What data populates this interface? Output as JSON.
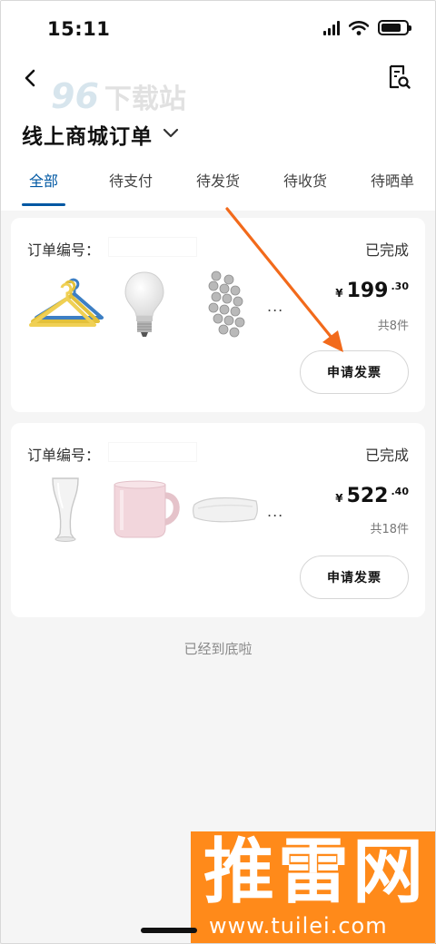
{
  "status_bar": {
    "time": "15:11"
  },
  "header": {
    "title": "线上商城订单"
  },
  "watermark": {
    "logo_num": "96",
    "logo_text": "下载站"
  },
  "tabs": [
    {
      "label": "全部",
      "active": true
    },
    {
      "label": "待支付",
      "active": false
    },
    {
      "label": "待发货",
      "active": false
    },
    {
      "label": "待收货",
      "active": false
    },
    {
      "label": "待晒单",
      "active": false
    }
  ],
  "orders": [
    {
      "order_label": "订单编号：",
      "status": "已完成",
      "price_symbol": "¥",
      "price_int": "199",
      "price_dec": ".30",
      "count": "共8件",
      "button": "申请发票",
      "items": [
        "hangers",
        "light-bulb",
        "hexagon-mirror"
      ],
      "more": "..."
    },
    {
      "order_label": "订单编号：",
      "status": "已完成",
      "price_symbol": "¥",
      "price_int": "522",
      "price_dec": ".40",
      "count": "共18件",
      "button": "申请发票",
      "items": [
        "beer-glass",
        "pink-mug",
        "pillow"
      ],
      "more": "..."
    }
  ],
  "footer_note": "已经到底啦",
  "brand_watermark": {
    "cn": "推雷网",
    "en": "www.tuilei.com"
  },
  "colors": {
    "accent": "#0058a3",
    "annotation_arrow": "#f26a1b",
    "brand_orange": "#ff8a1a"
  }
}
